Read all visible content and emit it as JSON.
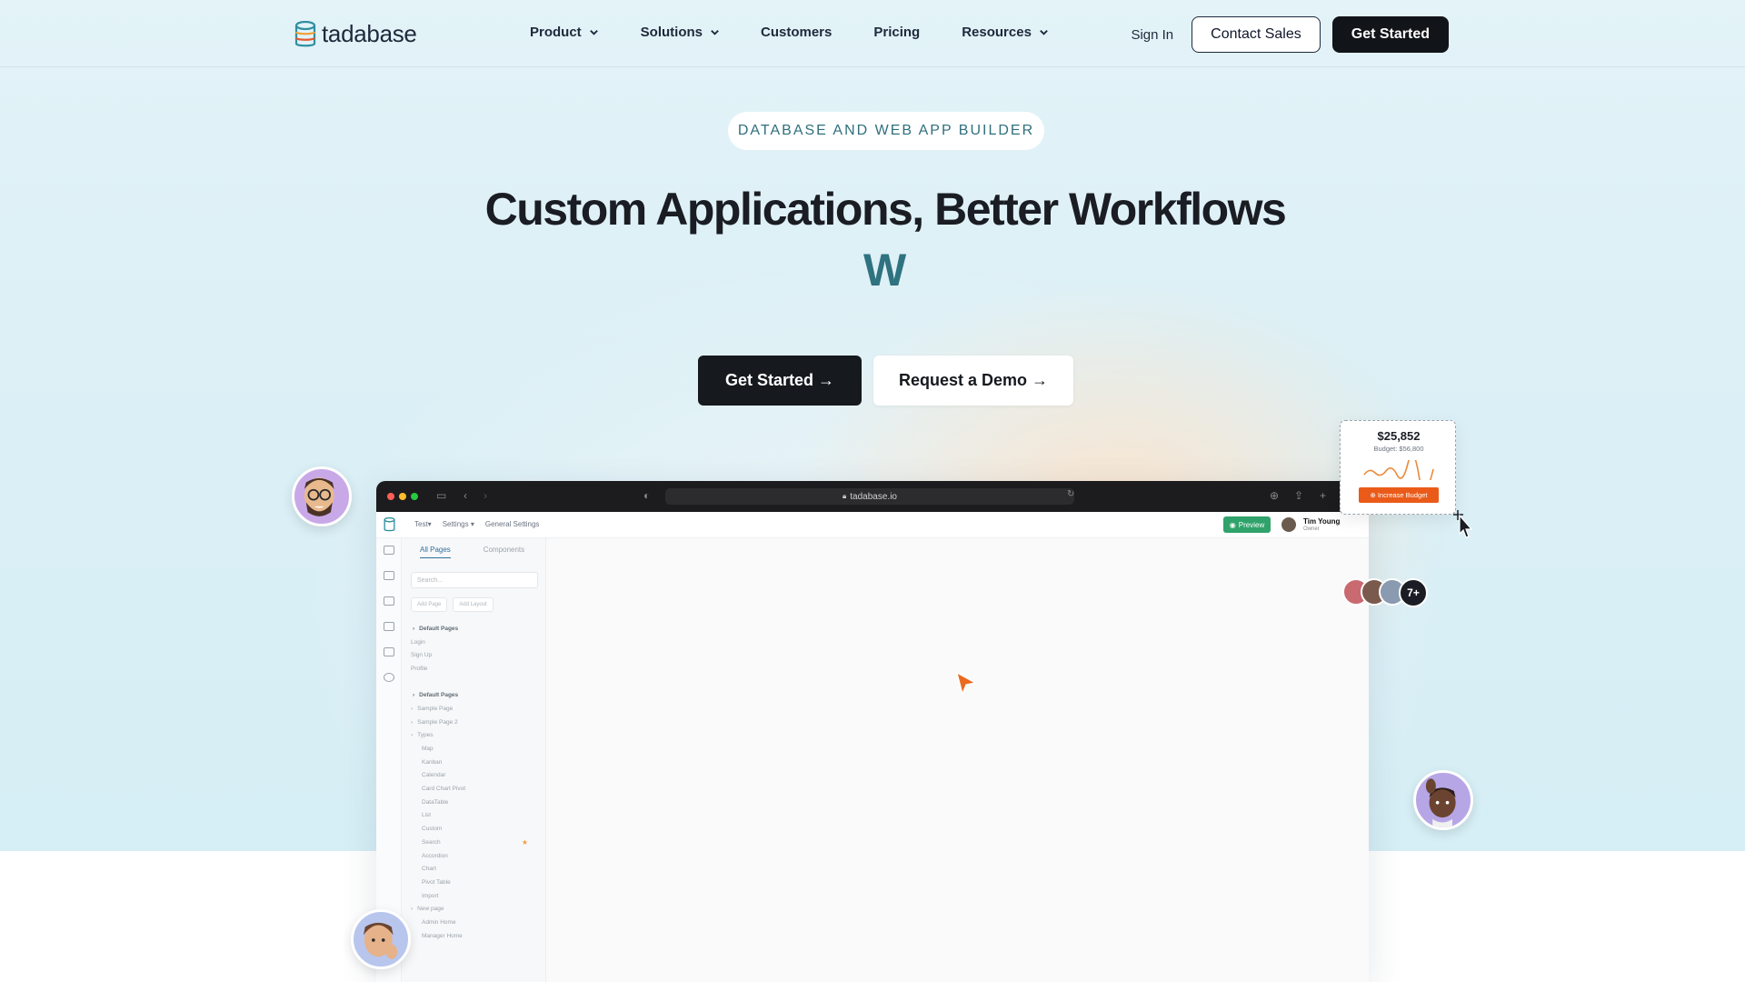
{
  "nav": {
    "logo_text": "tadabase",
    "links": [
      {
        "label": "Product",
        "has_dropdown": true
      },
      {
        "label": "Solutions",
        "has_dropdown": true
      },
      {
        "label": "Customers",
        "has_dropdown": false
      },
      {
        "label": "Pricing",
        "has_dropdown": false
      },
      {
        "label": "Resources",
        "has_dropdown": true
      }
    ],
    "sign_in": "Sign In",
    "contact_sales": "Contact Sales",
    "get_started": "Get Started"
  },
  "hero": {
    "eyebrow": "DATABASE AND WEB APP BUILDER",
    "headline": "Custom Applications, Better Workflows",
    "typed_text": "W",
    "cta_primary": "Get Started →",
    "cta_secondary": "Request a Demo →"
  },
  "browser": {
    "url": "tadabase.io",
    "breadcrumbs": [
      "Test▾",
      "Settings ▾",
      "General Settings"
    ],
    "preview_label": "Preview",
    "user_name": "Tim Young",
    "user_role": "Owner",
    "tabs": [
      "All Pages",
      "Components"
    ],
    "search_placeholder": "Search...",
    "add_page": "Add Page",
    "add_layout": "Add Layout",
    "pages": [
      {
        "label": "Default Pages",
        "type": "head"
      },
      {
        "label": "Login",
        "type": "item"
      },
      {
        "label": "Sign Up",
        "type": "item"
      },
      {
        "label": "Profile",
        "type": "item"
      },
      {
        "label": "",
        "type": "spacer"
      },
      {
        "label": "Default Pages",
        "type": "head"
      },
      {
        "label": "Sample Page",
        "type": "item"
      },
      {
        "label": "Sample Page 2",
        "type": "item"
      },
      {
        "label": "Types",
        "type": "item"
      },
      {
        "label": "Map",
        "type": "sub"
      },
      {
        "label": "Kanban",
        "type": "sub"
      },
      {
        "label": "Calendar",
        "type": "sub"
      },
      {
        "label": "Card Chart Pivot",
        "type": "sub"
      },
      {
        "label": "DataTable",
        "type": "sub"
      },
      {
        "label": "List",
        "type": "sub"
      },
      {
        "label": "Custom",
        "type": "sub"
      },
      {
        "label": "Search",
        "type": "sub",
        "starred": true
      },
      {
        "label": "Accordion",
        "type": "sub"
      },
      {
        "label": "Chart",
        "type": "sub"
      },
      {
        "label": "Pivot Table",
        "type": "sub"
      },
      {
        "label": "Import",
        "type": "sub"
      },
      {
        "label": "New page",
        "type": "item"
      },
      {
        "label": "Admin Home",
        "type": "sub"
      },
      {
        "label": "Manager Home",
        "type": "sub"
      }
    ]
  },
  "budget_card": {
    "amount": "$25,852",
    "budget": "Budget: $56,800",
    "button": "Increase Budget"
  },
  "avatar_stack": {
    "extra_count": "7+"
  },
  "colors": {
    "accent_teal": "#2f7280",
    "dark": "#16191d",
    "preview_green": "#2fa36b",
    "budget_orange": "#ea5b19",
    "hero_bg": "#dcf0f6"
  }
}
